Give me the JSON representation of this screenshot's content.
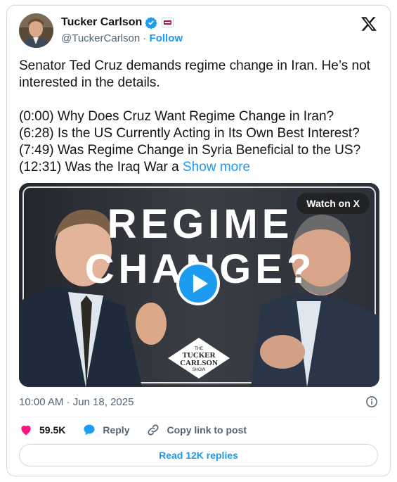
{
  "author": {
    "name": "Tucker Carlson",
    "handle": "@TuckerCarlson",
    "separator": "·",
    "follow_label": "Follow"
  },
  "tweet": {
    "line1": "Senator Ted Cruz demands regime change in Iran. He’s not interested in the details.",
    "chapters": [
      "(0:00) Why Does Cruz Want Regime Change in Iran?",
      "(6:28) Is the US Currently Acting in Its Own Best Interest?",
      "(7:49) Was Regime Change in Syria Beneficial to the US?",
      "(12:31) Was the Iraq War a"
    ],
    "show_more": "Show more"
  },
  "media": {
    "headline_1": "REGIME",
    "headline_2": "CHANGE?",
    "watch_label": "Watch on X",
    "logo_line1": "THE",
    "logo_line2": "TUCKER",
    "logo_line3": "CARLSON",
    "logo_line4": "SHOW"
  },
  "timestamp": "10:00 AM · Jun 18, 2025",
  "actions": {
    "likes": "59.5K",
    "reply_label": "Reply",
    "copy_label": "Copy link to post"
  },
  "replies_button": "Read 12K replies",
  "colors": {
    "accent": "#1d9bf0",
    "like": "#f91880",
    "secondary_text": "#536471",
    "border": "#cfd9de"
  }
}
